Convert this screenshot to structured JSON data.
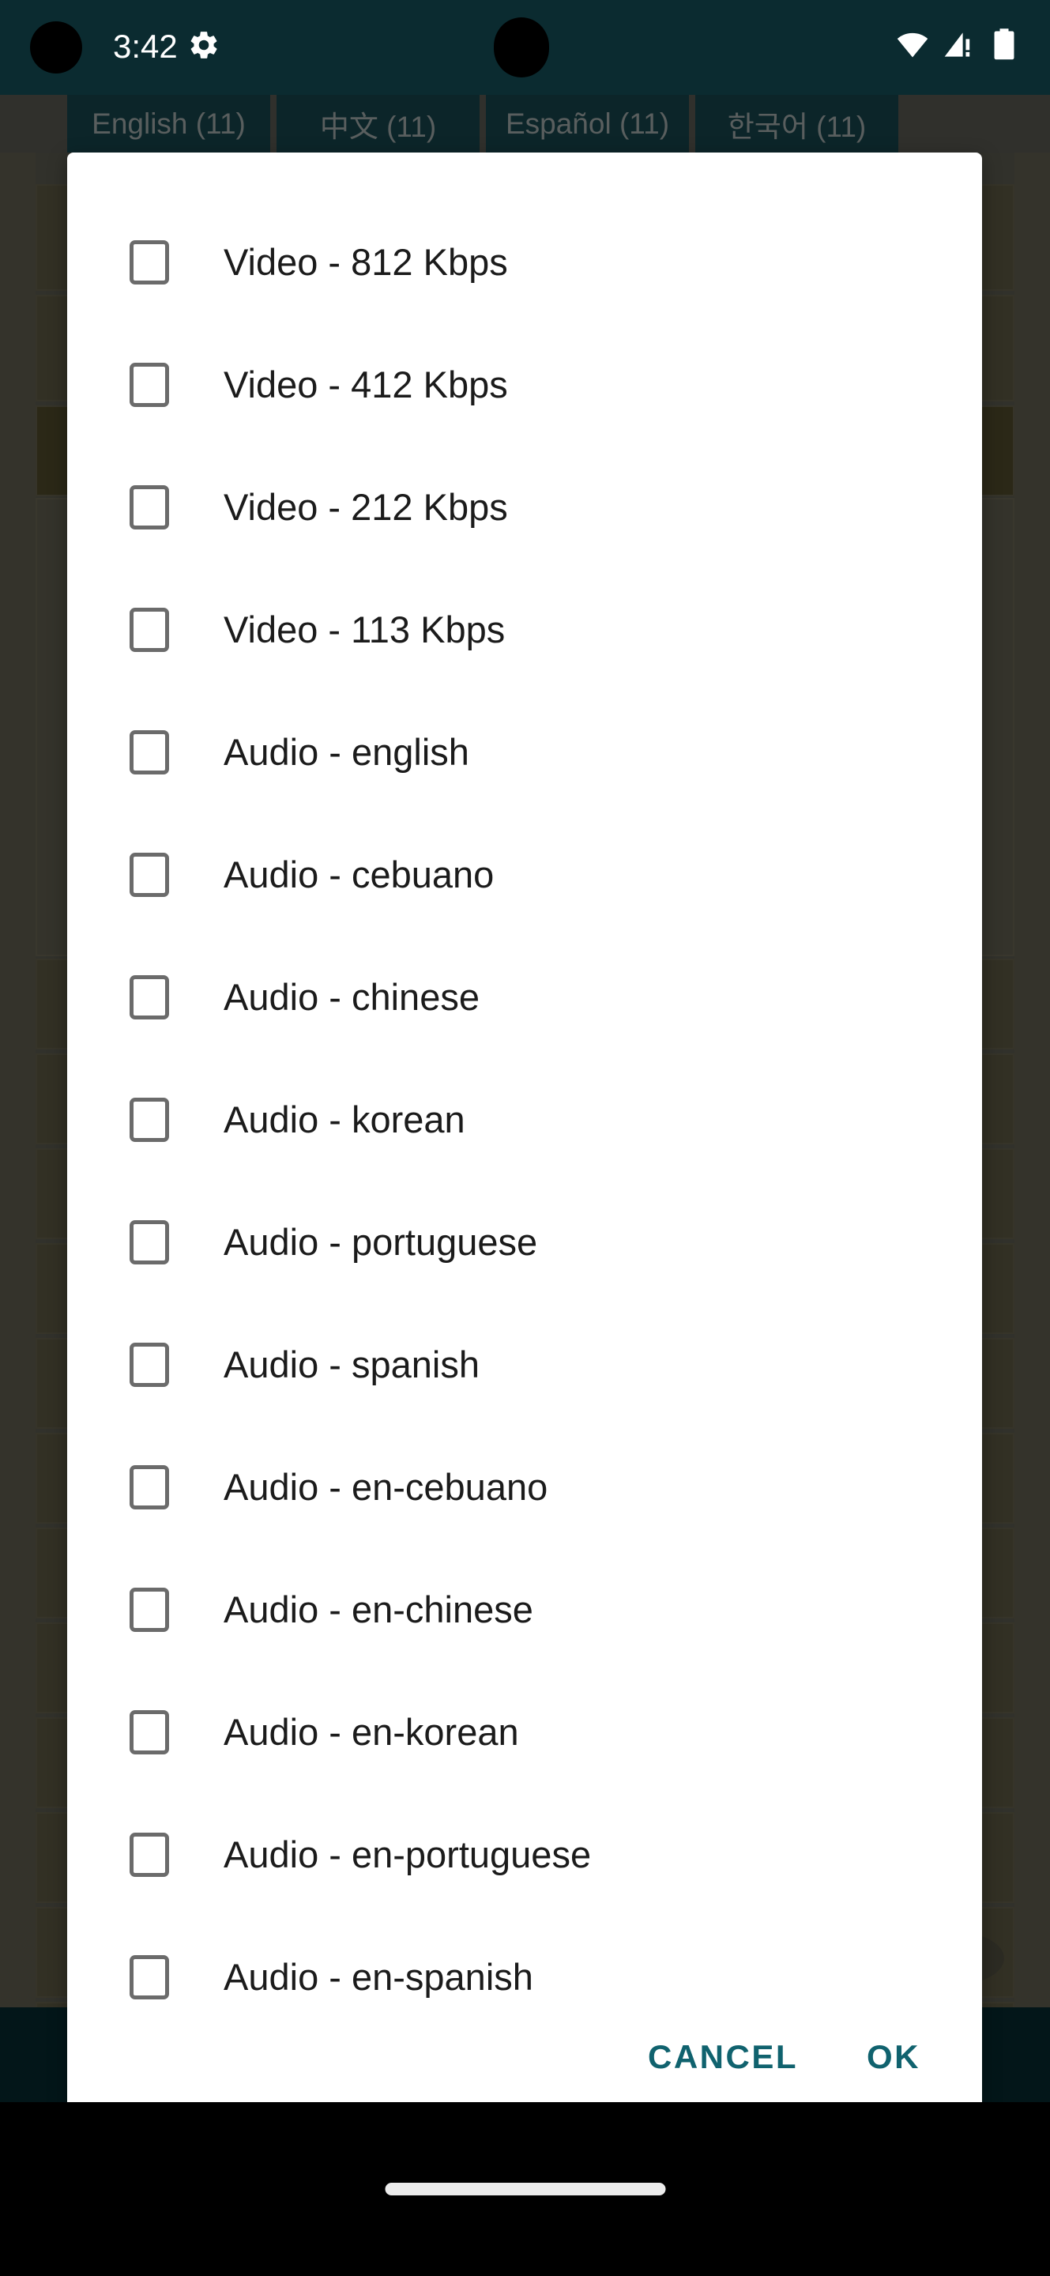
{
  "status_bar": {
    "time": "3:42",
    "icons": [
      "gear-icon",
      "wifi-icon",
      "cellular-signal-no-sim-icon",
      "battery-icon"
    ]
  },
  "background_app": {
    "tabs": [
      {
        "label": "English (11)"
      },
      {
        "label": "中文 (11)"
      },
      {
        "label": "Español (11)"
      },
      {
        "label": "한국어 (11)"
      }
    ]
  },
  "dialog": {
    "options": [
      {
        "label": "Video - 812 Kbps",
        "checked": false
      },
      {
        "label": "Video - 412 Kbps",
        "checked": false
      },
      {
        "label": "Video - 212 Kbps",
        "checked": false
      },
      {
        "label": "Video - 113 Kbps",
        "checked": false
      },
      {
        "label": "Audio - english",
        "checked": false
      },
      {
        "label": "Audio - cebuano",
        "checked": false
      },
      {
        "label": "Audio - chinese",
        "checked": false
      },
      {
        "label": "Audio - korean",
        "checked": false
      },
      {
        "label": "Audio - portuguese",
        "checked": false
      },
      {
        "label": "Audio - spanish",
        "checked": false
      },
      {
        "label": "Audio - en-cebuano",
        "checked": false
      },
      {
        "label": "Audio - en-chinese",
        "checked": false
      },
      {
        "label": "Audio - en-korean",
        "checked": false
      },
      {
        "label": "Audio - en-portuguese",
        "checked": false
      },
      {
        "label": "Audio - en-spanish",
        "checked": false
      }
    ],
    "cancel_label": "CANCEL",
    "ok_label": "OK"
  },
  "colors": {
    "accent": "#10626e",
    "status_bar_bg": "#0b2b30",
    "tab_bg": "#164148",
    "dialog_bg": "#ffffff",
    "checkbox_border": "#6b6b6b",
    "nav_bar_bg": "#000000"
  }
}
